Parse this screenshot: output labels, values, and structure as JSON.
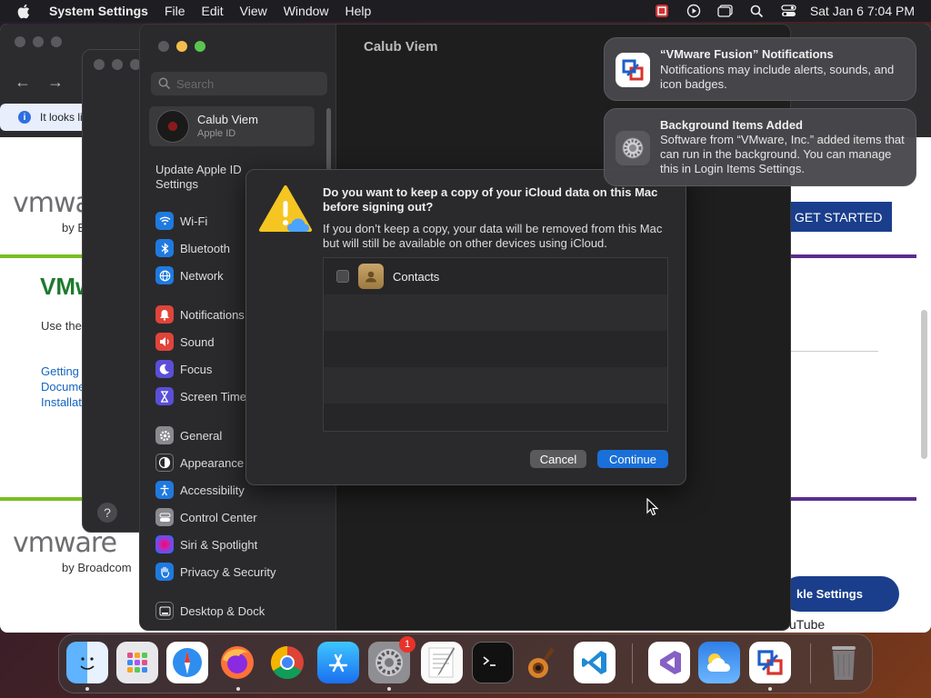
{
  "menubar": {
    "app_name": "System Settings",
    "items": [
      "File",
      "Edit",
      "View",
      "Window",
      "Help"
    ],
    "clock": "Sat Jan 6  7:04 PM",
    "status_icons": [
      "vmware-fusion-icon",
      "play-circle-icon",
      "window-icon",
      "search-icon",
      "control-center-icon"
    ]
  },
  "browser": {
    "info_text": "It looks li",
    "logo_text": "vmware",
    "logo_by": "by B",
    "logo_text_2": "vmware",
    "logo_by_2": "by Broadcom",
    "heading": "VMw",
    "use_text": "Use the",
    "links": [
      "Getting",
      "Docume",
      "Installat"
    ],
    "get_started": "GET STARTED",
    "pill_text": "kle Settings",
    "youtube": "uTube"
  },
  "settings": {
    "window_title": "Calub Viem",
    "search_placeholder": "Search",
    "account_name": "Calub Viem",
    "account_sub": "Apple ID",
    "update_text": "Update Apple ID Settings",
    "sidebar": [
      {
        "label": "Wi-Fi",
        "icon": "wifi-icon",
        "color": "#1f7ae0"
      },
      {
        "label": "Bluetooth",
        "icon": "bluetooth-icon",
        "color": "#1f7ae0"
      },
      {
        "label": "Network",
        "icon": "globe-icon",
        "color": "#1f7ae0"
      },
      {
        "label": "Notifications",
        "icon": "bell-icon",
        "color": "#e0443a"
      },
      {
        "label": "Sound",
        "icon": "speaker-icon",
        "color": "#e0443a"
      },
      {
        "label": "Focus",
        "icon": "moon-icon",
        "color": "#5b4fd8"
      },
      {
        "label": "Screen Time",
        "icon": "hourglass-icon",
        "color": "#5b4fd8"
      },
      {
        "label": "General",
        "icon": "gear-icon",
        "color": "#8a8a8e"
      },
      {
        "label": "Appearance",
        "icon": "appearance-icon",
        "color": "#2a2a2c"
      },
      {
        "label": "Accessibility",
        "icon": "accessibility-icon",
        "color": "#1f7ae0"
      },
      {
        "label": "Control Center",
        "icon": "control-center-icon",
        "color": "#8a8a8e"
      },
      {
        "label": "Siri & Spotlight",
        "icon": "siri-icon",
        "color": "#b03ad0"
      },
      {
        "label": "Privacy & Security",
        "icon": "hand-icon",
        "color": "#1f7ae0"
      },
      {
        "label": "Desktop & Dock",
        "icon": "dock-icon",
        "color": "#2a2a2c"
      }
    ]
  },
  "dialog": {
    "title": "Do you want to keep a copy of your iCloud data on this Mac before signing out?",
    "message": "If you don’t keep a copy, your data will be removed from this Mac but will still be available on other devices using iCloud.",
    "items": [
      {
        "label": "Contacts",
        "checked": false
      }
    ],
    "cancel": "Cancel",
    "continue": "Continue"
  },
  "notifications": [
    {
      "title": "“VMware Fusion” Notifications",
      "body": "Notifications may include alerts, sounds, and icon badges.",
      "icon": "vmware-fusion-icon"
    },
    {
      "title": "Background Items Added",
      "body": "Software from “VMware, Inc.” added items that can run in the background. You can manage this in Login Items Settings.",
      "icon": "settings-gear-icon"
    }
  ],
  "dock": {
    "apps": [
      "Finder",
      "Launchpad",
      "Safari",
      "Firefox",
      "Chrome",
      "App Store",
      "System Settings",
      "TextEdit",
      "Terminal",
      "GarageBand",
      "Visual Studio Code",
      "Visual Studio",
      "Weather",
      "VMware Fusion",
      "Trash"
    ],
    "settings_badge": "1"
  }
}
